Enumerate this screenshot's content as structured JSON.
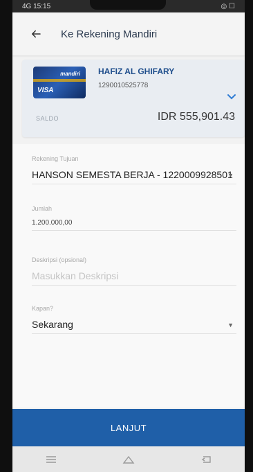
{
  "status_bar": {
    "left": "4G 15:15",
    "right": "◎ ☐"
  },
  "header": {
    "back_icon": "arrow-left-icon",
    "title": "Ke Rekening Mandiri"
  },
  "account": {
    "card_brand": "mandiri",
    "card_network": "VISA",
    "name": "HAFIZ AL GHIFARY",
    "number": "1290010525778",
    "balance_label": "SALDO",
    "balance_value": "IDR 555,901.43"
  },
  "form": {
    "destination": {
      "label": "Rekening Tujuan",
      "value": "HANSON SEMESTA BERJA - 1220009928501"
    },
    "amount": {
      "label": "Jumlah",
      "value": "1.200.000,00"
    },
    "description": {
      "label": "Deskripsi (opsional)",
      "placeholder": "Masukkan Deskripsi"
    },
    "when": {
      "label": "Kapan?",
      "value": "Sekarang"
    }
  },
  "button": {
    "label": "LANJUT"
  },
  "colors": {
    "primary": "#1f5fa8",
    "accent": "#2e7bd4",
    "text_dark": "#222222"
  }
}
